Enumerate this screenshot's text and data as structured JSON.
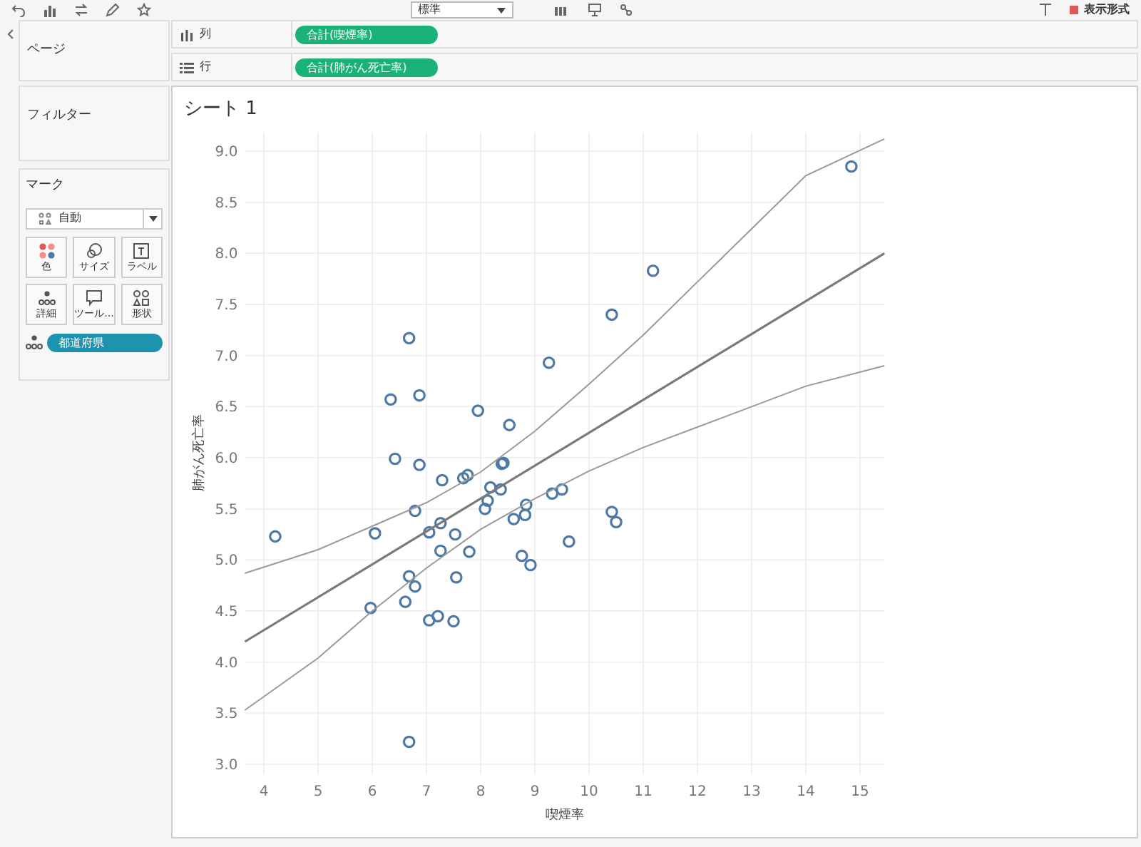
{
  "toolbar": {
    "format_select": "標準",
    "show_me": "表示形式"
  },
  "pages_panel": {
    "title": "ページ"
  },
  "shelves": [
    {
      "kind": "columns",
      "label": "列",
      "pill": "合計(喫煙率)"
    },
    {
      "kind": "rows",
      "label": "行",
      "pill": "合計(肺がん死亡率)"
    }
  ],
  "filters_panel": {
    "title": "フィルター"
  },
  "marks_panel": {
    "title": "マーク",
    "mark_type": "自動",
    "buttons": [
      {
        "kind": "color",
        "label": "色"
      },
      {
        "kind": "size",
        "label": "サイズ"
      },
      {
        "kind": "label",
        "label": "ラベル"
      },
      {
        "kind": "detail",
        "label": "詳細"
      },
      {
        "kind": "tooltip",
        "label": "ツール..."
      },
      {
        "kind": "shape",
        "label": "形状"
      }
    ],
    "detail_pill": "都道府県"
  },
  "sheet": {
    "title": "シート 1",
    "chart_data": {
      "type": "scatter",
      "xlabel": "喫煙率",
      "ylabel": "肺がん死亡率",
      "xlim": [
        3.65,
        15.45
      ],
      "ylim": [
        2.9,
        9.2
      ],
      "xticks": [
        4,
        5,
        6,
        7,
        8,
        9,
        10,
        11,
        12,
        13,
        14,
        15
      ],
      "yticks": [
        {
          "value": 3,
          "label": "3.0"
        },
        {
          "value": 3.5,
          "label": "3.5"
        },
        {
          "value": 4,
          "label": "4.0"
        },
        {
          "value": 4.5,
          "label": "4.5"
        },
        {
          "value": 5,
          "label": "5.0"
        },
        {
          "value": 5.5,
          "label": "5.5"
        },
        {
          "value": 6,
          "label": "6.0"
        },
        {
          "value": 6.5,
          "label": "6.5"
        },
        {
          "value": 7,
          "label": "7.0"
        },
        {
          "value": 7.5,
          "label": "7.5"
        },
        {
          "value": 8,
          "label": "8.0"
        },
        {
          "value": 8.5,
          "label": "8.5"
        },
        {
          "value": 9,
          "label": "9.0"
        }
      ],
      "x": [
        14.84,
        11.18,
        10.42,
        6.68,
        9.26,
        6.87,
        6.34,
        7.95,
        8.53,
        6.42,
        6.87,
        8.42,
        8.39,
        7.76,
        7.68,
        7.29,
        8.18,
        8.37,
        9.5,
        9.32,
        8.13,
        8.84,
        8.08,
        6.79,
        10.42,
        10.5,
        7.26,
        8.82,
        8.61,
        4.21,
        6.05,
        7.05,
        7.53,
        9.63,
        7.26,
        7.79,
        8.76,
        8.92,
        6.68,
        7.55,
        6.79,
        5.97,
        6.61,
        7.21,
        7.05,
        7.5,
        6.68
      ],
      "series": [
        {
          "color": "#4e79a7",
          "values": [
            8.85,
            7.83,
            7.4,
            7.17,
            6.93,
            6.61,
            6.57,
            6.46,
            6.32,
            5.99,
            5.93,
            5.95,
            5.94,
            5.83,
            5.8,
            5.78,
            5.71,
            5.69,
            5.69,
            5.65,
            5.58,
            5.54,
            5.5,
            5.48,
            5.47,
            5.37,
            5.36,
            5.44,
            5.4,
            5.23,
            5.26,
            5.27,
            5.25,
            5.18,
            5.09,
            5.08,
            5.04,
            4.95,
            4.84,
            4.83,
            4.74,
            4.53,
            4.59,
            4.45,
            4.41,
            4.4,
            3.22
          ]
        }
      ],
      "grid": true
    }
  }
}
